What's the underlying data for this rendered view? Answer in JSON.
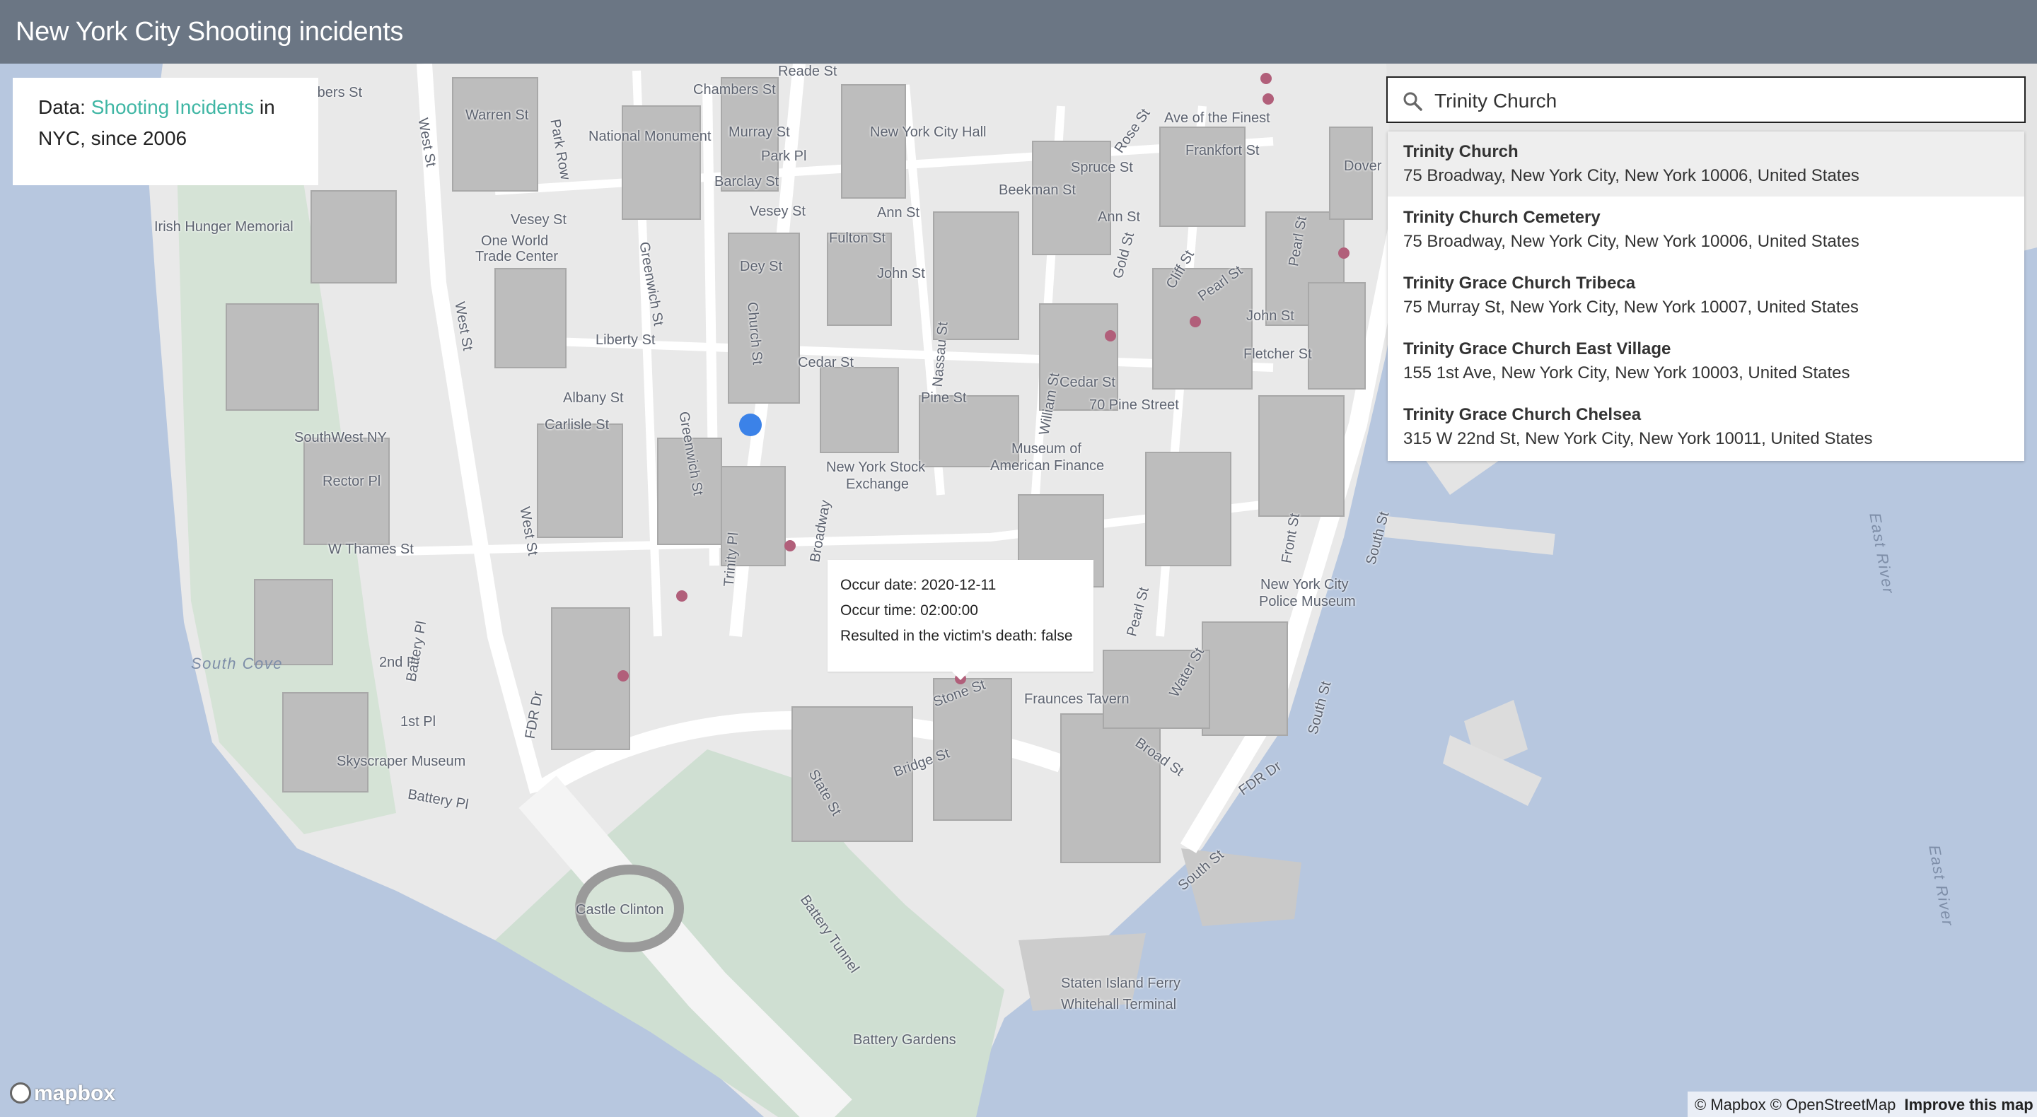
{
  "header": {
    "title": "New York City Shooting incidents"
  },
  "info": {
    "prefix": "Data: ",
    "link_text": "Shooting Incidents",
    "suffix_line1": " in",
    "line2": "NYC, since 2006"
  },
  "search": {
    "value": "Trinity Church",
    "icon": "search-icon"
  },
  "suggestions": [
    {
      "name": "Trinity Church",
      "address": "75 Broadway, New York City, New York 10006, United States"
    },
    {
      "name": "Trinity Church Cemetery",
      "address": "75 Broadway, New York City, New York 10006, United States"
    },
    {
      "name": "Trinity Grace Church Tribeca",
      "address": "75 Murray St, New York City, New York 10007, United States"
    },
    {
      "name": "Trinity Grace Church East Village",
      "address": "155 1st Ave, New York City, New York 10003, United States"
    },
    {
      "name": "Trinity Grace Church Chelsea",
      "address": "315 W 22nd St, New York City, New York 10011, United States"
    }
  ],
  "popup": {
    "occur_date": "Occur date: 2020-12-11",
    "occur_time": "Occur time: 02:00:00",
    "death": "Resulted in the victim's death: false"
  },
  "map_labels": {
    "chambers": "Chambers St",
    "warren": "Warren St",
    "murray": "Murray St",
    "park_pl": "Park Pl",
    "barclay": "Barclay St",
    "vesey": "Vesey St",
    "vesey2": "Vesey St",
    "dey": "Dey St",
    "fulton": "Fulton St",
    "john": "John St",
    "liberty": "Liberty St",
    "cedar": "Cedar St",
    "albany": "Albany St",
    "carlisle": "Carlisle St",
    "rector": "Rector Pl",
    "thames": "W Thames St",
    "south_cove": "South Cove",
    "second_pl": "2nd Pl",
    "first_pl": "1st Pl",
    "skyscraper": "Skyscraper Museum",
    "battery_pl": "Battery Pl",
    "castle": "Castle Clinton",
    "battery_tunnel": "Battery Tunnel",
    "battery_gardens": "Battery Gardens",
    "ferry1": "Staten Island Ferry",
    "ferry2": "Whitehall Terminal",
    "fraunces": "Fraunces Tavern",
    "stock1": "New York Stock",
    "stock2": "Exchange",
    "museum1": "Museum of",
    "museum2": "American Finance",
    "pine_st": "70 Pine Street",
    "pine": "Pine St",
    "police1": "New York City",
    "police2": "Police Museum",
    "frankfort": "Frankfort St",
    "spruce": "Spruce St",
    "beekman": "Beekman St",
    "ann": "Ann St",
    "ann2": "Ann St",
    "fletcher": "Fletcher St",
    "john2": "John St",
    "cedar2": "Cedar St",
    "irish": "Irish Hunger Memorial",
    "owtc1": "One World",
    "owtc2": "Trade Center",
    "southwest": "SouthWest NY",
    "national": "National Monument",
    "city_hall": "New York City Hall",
    "west_st": "West St",
    "west_st2": "West St",
    "west_st3": "West St",
    "greenwich": "Greenwich St",
    "greenwich2": "Greenwich St",
    "church": "Church St",
    "trinity_pl": "Trinity Pl",
    "broadway": "Broadway",
    "nassau": "Nassau St",
    "william": "William St",
    "fdr": "FDR Dr",
    "fdr2": "FDR Dr",
    "state": "State St",
    "bridge": "Bridge St",
    "stone": "Stone St",
    "broad": "Broad St",
    "water": "Water St",
    "south": "South St",
    "south2": "South St",
    "south3": "South St",
    "front": "Front St",
    "pearl": "Pearl St",
    "pearl2": "Pearl St",
    "pearl3": "Pearl St",
    "battery_pl2": "Battery Pl",
    "east_river1": "East River",
    "east_river2": "East River",
    "rose": "Rose St",
    "finest": "Ave of the Finest",
    "dover": "Dover",
    "gold": "Gold St",
    "cliff": "Cliff St",
    "reade": "Reade St",
    "chambers_top": "mbers St",
    "row": "Park Row"
  },
  "attribution": {
    "mapbox": "© Mapbox",
    "osm": "© OpenStreetMap",
    "improve": "Improve this map"
  },
  "logo": {
    "text": "mapbox"
  }
}
